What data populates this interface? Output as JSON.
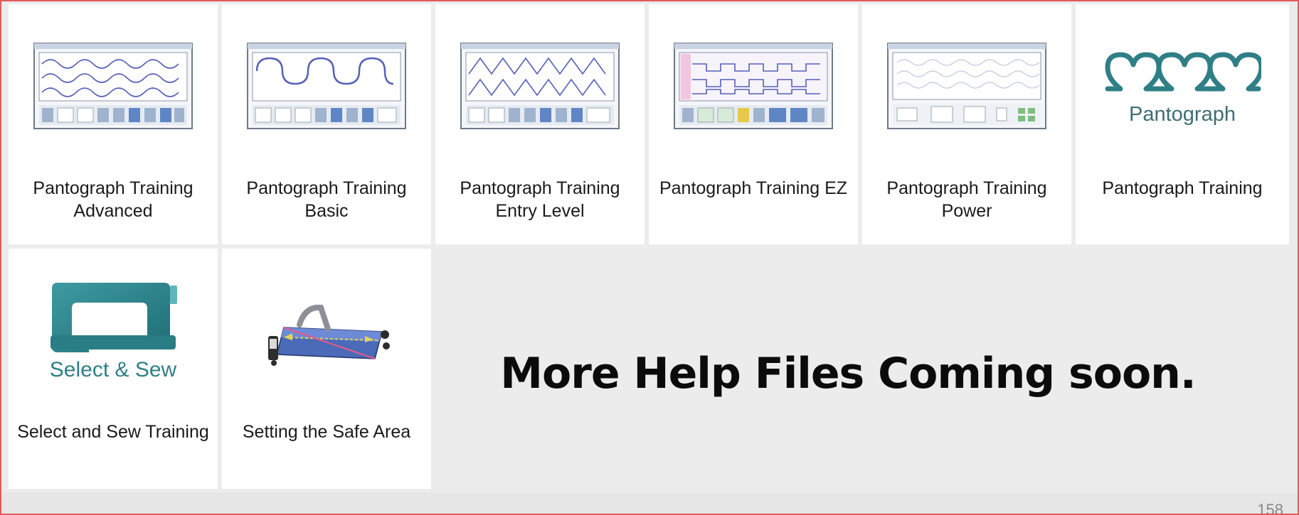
{
  "tiles": [
    {
      "label": "Pantograph Training Advanced",
      "icon": "pantograph-advanced-screenshot-icon"
    },
    {
      "label": "Pantograph Training Basic",
      "icon": "pantograph-basic-screenshot-icon"
    },
    {
      "label": "Pantograph Training Entry Level",
      "icon": "pantograph-entry-screenshot-icon"
    },
    {
      "label": "Pantograph Training EZ",
      "icon": "pantograph-ez-screenshot-icon"
    },
    {
      "label": "Pantograph Training Power",
      "icon": "pantograph-power-screenshot-icon"
    },
    {
      "label": "Pantograph Training",
      "icon": "pantograph-logo-icon",
      "logo_text": "Pantograph"
    },
    {
      "label": "Select and Sew Training",
      "icon": "sewing-machine-icon",
      "logo_text": "Select & Sew"
    },
    {
      "label": "Setting the Safe Area",
      "icon": "quilting-machine-icon"
    }
  ],
  "coming_soon": {
    "text": "More Help Files Coming soon."
  },
  "page_number": "158",
  "colors": {
    "frame_border": "#e25a5a",
    "background": "#ececec",
    "tile": "#ffffff",
    "teal": "#2f7f86",
    "logo_text": "#3d6e74"
  }
}
